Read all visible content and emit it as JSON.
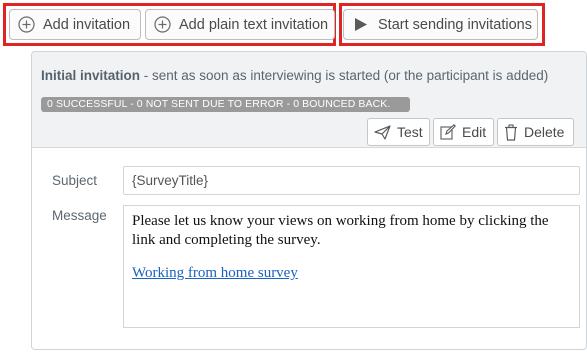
{
  "toolbar": {
    "add_invitation_label": "Add invitation",
    "add_plain_label": "Add plain text invitation",
    "start_sending_label": "Start sending invitations"
  },
  "invitation": {
    "title": "Initial invitation",
    "description": " - sent as soon as interviewing is started (or the participant is added)",
    "status": "0 SUCCESSFUL - 0 NOT SENT DUE TO ERROR - 0 BOUNCED BACK.",
    "actions": {
      "test_label": "Test",
      "edit_label": "Edit",
      "delete_label": "Delete"
    },
    "subject_label": "Subject",
    "subject_value": "{SurveyTitle}",
    "message_label": "Message",
    "message_body": "Please let us know your views on working from home by clicking the link and completing the survey.",
    "message_link": "Working from home survey"
  },
  "colors": {
    "highlight": "#e02424",
    "badge": "#9a9a9a",
    "link": "#1a63c0"
  },
  "icons": {
    "add": "plus-circle-icon",
    "start": "play-icon",
    "test": "send-icon",
    "edit": "edit-icon",
    "delete": "trash-icon"
  }
}
